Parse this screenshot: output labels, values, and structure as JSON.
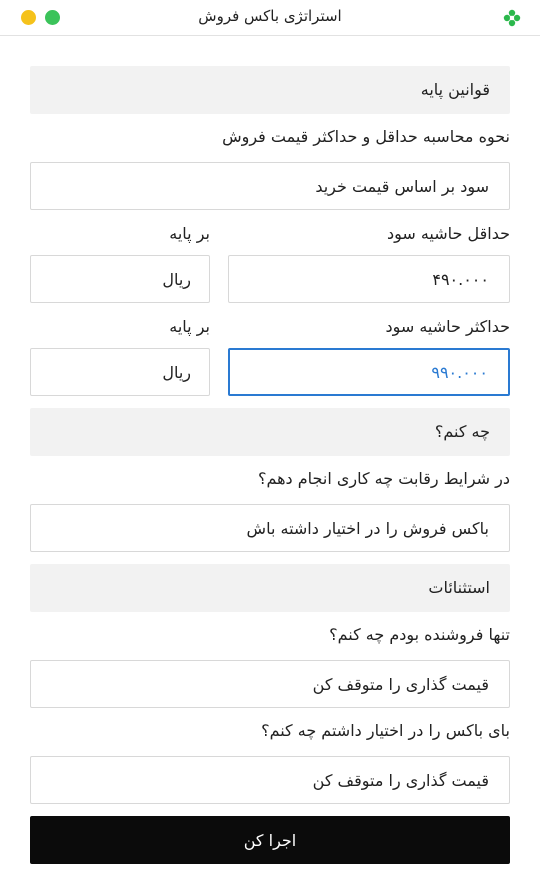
{
  "window": {
    "title": "استراتژی باکس فروش"
  },
  "sections": {
    "base_rules": "قوانین پایه",
    "what_to_do": "چه کنم؟",
    "exceptions": "استثنائات"
  },
  "pricing_method": {
    "label": "نحوه محاسبه حداقل و حداکثر قیمت فروش",
    "value": "سود بر اساس قیمت خرید"
  },
  "min_margin": {
    "label": "حداقل حاشیه سود",
    "value": "۴۹۰.۰۰۰",
    "unit_label": "بر پایه",
    "unit_value": "ریال"
  },
  "max_margin": {
    "label": "حداکثر حاشیه سود",
    "value": "۹۹۰.۰۰۰",
    "unit_label": "بر پایه",
    "unit_value": "ریال"
  },
  "competition": {
    "label": "در شرایط رقابت چه کاری انجام دهم؟",
    "value": "باکس فروش را در اختیار داشته باش"
  },
  "only_seller": {
    "label": "تنها فروشنده بودم چه کنم؟",
    "value": "قیمت گذاری را متوقف کن"
  },
  "buy_box": {
    "label": "بای باکس را در اختیار داشتم چه کنم؟",
    "value": "قیمت گذاری را متوقف کن"
  },
  "run_button": "اجرا کن",
  "colors": {
    "accent": "#2a7ad2",
    "button_bg": "#0b0b0b",
    "section_bg": "#f2f2f2"
  }
}
